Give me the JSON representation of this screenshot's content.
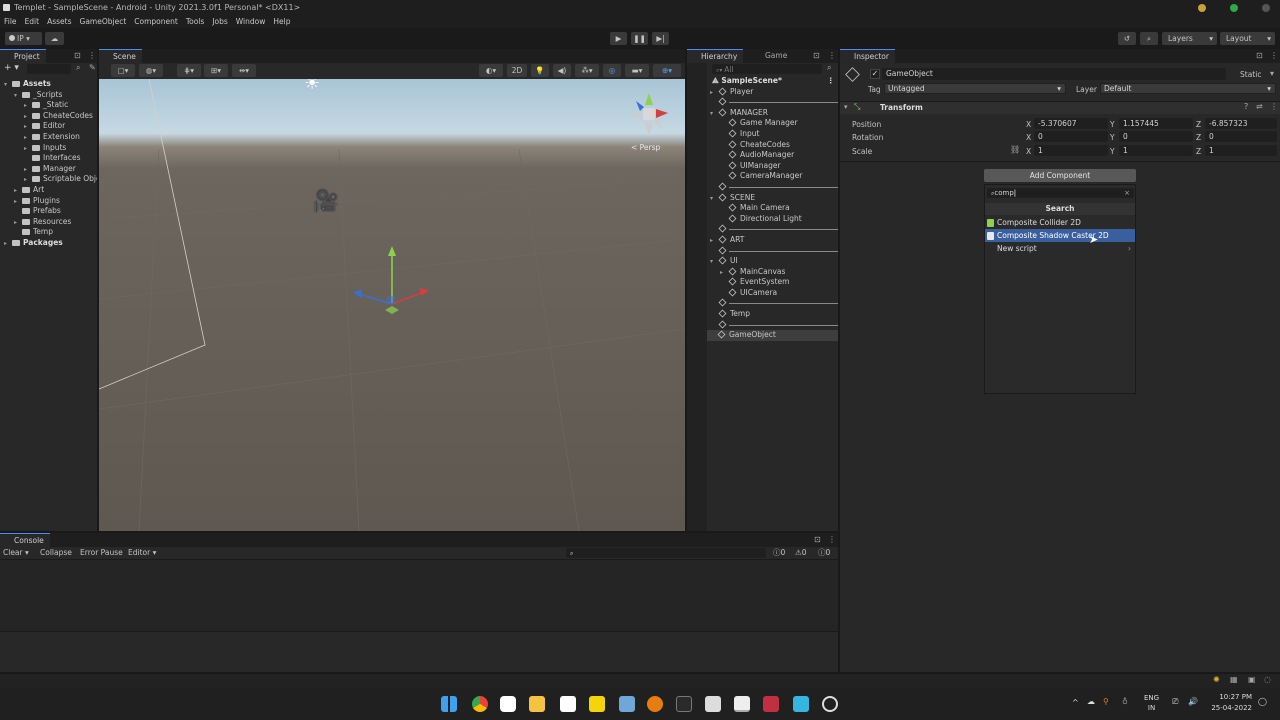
{
  "window": {
    "title": "Templet - SampleScene - Android - Unity 2021.3.0f1 Personal* <DX11>"
  },
  "menu": [
    "File",
    "Edit",
    "Assets",
    "GameObject",
    "Component",
    "Tools",
    "Jobs",
    "Window",
    "Help"
  ],
  "toolbar": {
    "account": "IP ▾",
    "layers": "Layers",
    "layout": "Layout"
  },
  "project": {
    "tab": "Project",
    "tree": [
      {
        "label": "Assets",
        "depth": 0,
        "bold": true,
        "open": true
      },
      {
        "label": "_Scripts",
        "depth": 1,
        "open": true
      },
      {
        "label": "_Static",
        "depth": 2
      },
      {
        "label": "CheateCodes",
        "depth": 2
      },
      {
        "label": "Editor",
        "depth": 2
      },
      {
        "label": "Extension",
        "depth": 2
      },
      {
        "label": "Inputs",
        "depth": 2
      },
      {
        "label": "Interfaces",
        "depth": 2,
        "leaf": true
      },
      {
        "label": "Manager",
        "depth": 2
      },
      {
        "label": "Scriptable Obje",
        "depth": 2
      },
      {
        "label": "Art",
        "depth": 1
      },
      {
        "label": "Plugins",
        "depth": 1
      },
      {
        "label": "Prefabs",
        "depth": 1,
        "leaf": true
      },
      {
        "label": "Resources",
        "depth": 1
      },
      {
        "label": "Temp",
        "depth": 1,
        "leaf": true
      },
      {
        "label": "Packages",
        "depth": 0,
        "bold": true
      }
    ]
  },
  "scene": {
    "tab": "Scene",
    "mode2d": "2D",
    "persp": "< Persp"
  },
  "hierarchy": {
    "tab": "Hierarchy",
    "tab2": "Game",
    "search_placeholder": "All",
    "scene_name": "SampleScene*",
    "items": [
      {
        "label": "Player",
        "depth": 1,
        "type": "obj",
        "collapsed": true
      },
      {
        "label": "",
        "depth": 1,
        "type": "sep"
      },
      {
        "label": "MANAGER",
        "depth": 1,
        "type": "obj",
        "open": true
      },
      {
        "label": "Game Manager",
        "depth": 2,
        "type": "obj"
      },
      {
        "label": "Input",
        "depth": 2,
        "type": "obj"
      },
      {
        "label": "CheateCodes",
        "depth": 2,
        "type": "obj"
      },
      {
        "label": "AudioManager",
        "depth": 2,
        "type": "obj"
      },
      {
        "label": "UIManager",
        "depth": 2,
        "type": "obj"
      },
      {
        "label": "CameraManager",
        "depth": 2,
        "type": "obj"
      },
      {
        "label": "",
        "depth": 1,
        "type": "sep"
      },
      {
        "label": "SCENE",
        "depth": 1,
        "type": "obj",
        "open": true
      },
      {
        "label": "Main Camera",
        "depth": 2,
        "type": "obj"
      },
      {
        "label": "Directional Light",
        "depth": 2,
        "type": "obj"
      },
      {
        "label": "",
        "depth": 1,
        "type": "sep"
      },
      {
        "label": "ART",
        "depth": 1,
        "type": "obj",
        "collapsed": true
      },
      {
        "label": "",
        "depth": 1,
        "type": "sep"
      },
      {
        "label": "UI",
        "depth": 1,
        "type": "obj",
        "open": true
      },
      {
        "label": "MainCanvas",
        "depth": 2,
        "type": "obj",
        "collapsed": true
      },
      {
        "label": "EventSystem",
        "depth": 2,
        "type": "obj"
      },
      {
        "label": "UICamera",
        "depth": 2,
        "type": "obj"
      },
      {
        "label": "",
        "depth": 1,
        "type": "sep"
      },
      {
        "label": "Temp",
        "depth": 1,
        "type": "obj"
      },
      {
        "label": "",
        "depth": 1,
        "type": "sep"
      },
      {
        "label": "GameObject",
        "depth": 1,
        "type": "obj",
        "selected": true
      }
    ]
  },
  "inspector": {
    "tab": "Inspector",
    "object_name": "GameObject",
    "static_label": "Static",
    "tag_label": "Tag",
    "tag_value": "Untagged",
    "layer_label": "Layer",
    "layer_value": "Default",
    "transform_title": "Transform",
    "position": {
      "label": "Position",
      "x": "-5.370607",
      "y": "1.157445",
      "z": "-6.857323"
    },
    "rotation": {
      "label": "Rotation",
      "x": "0",
      "y": "0",
      "z": "0"
    },
    "scale": {
      "label": "Scale",
      "x": "1",
      "y": "1",
      "z": "1"
    },
    "add_component": "Add Component",
    "search_value": "comp",
    "search_header": "Search",
    "results": [
      {
        "label": "Composite Collider 2D",
        "selected": false
      },
      {
        "label": "Composite Shadow Caster 2D",
        "selected": true
      },
      {
        "label": "New script",
        "selected": false,
        "submenu": true
      }
    ]
  },
  "console": {
    "tab": "Console",
    "clear": "Clear",
    "collapse": "Collapse",
    "error_pause": "Error Pause",
    "editor": "Editor",
    "count_info": "0",
    "count_warn": "0",
    "count_err": "0"
  },
  "taskbar": {
    "lang1": "ENG",
    "lang2": "IN",
    "time": "10:27 PM",
    "date": "25-04-2022"
  },
  "colors": {
    "accent": "#4a8cff",
    "selection": "#2c5d87",
    "dropdown_sel": "#3a5f9e",
    "gizmo_y": "#8bd44a",
    "gizmo_x": "#d43f3f",
    "gizmo_z": "#3a6fd4"
  }
}
